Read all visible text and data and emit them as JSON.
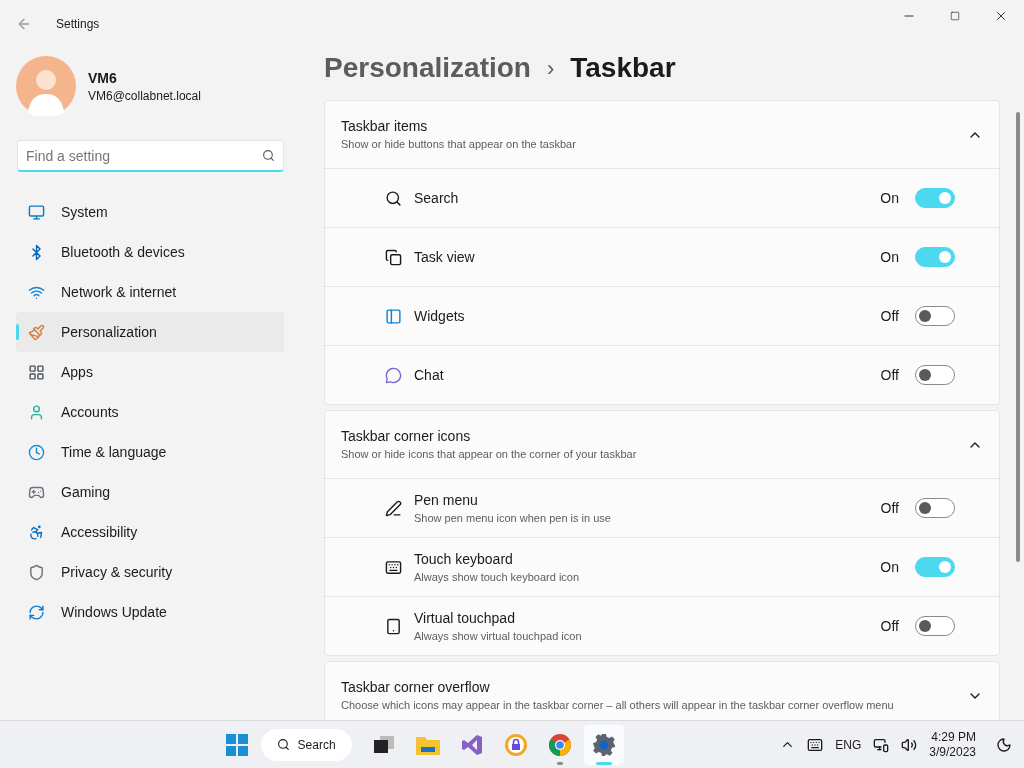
{
  "window": {
    "title": "Settings"
  },
  "profile": {
    "name": "VM6",
    "email": "VM6@collabnet.local"
  },
  "search": {
    "placeholder": "Find a setting"
  },
  "sidebar": {
    "items": [
      {
        "kind": "system",
        "label": "System",
        "selected": false
      },
      {
        "kind": "bluetooth",
        "label": "Bluetooth & devices",
        "selected": false
      },
      {
        "kind": "network",
        "label": "Network & internet",
        "selected": false
      },
      {
        "kind": "personalization",
        "label": "Personalization",
        "selected": true
      },
      {
        "kind": "apps",
        "label": "Apps",
        "selected": false
      },
      {
        "kind": "accounts",
        "label": "Accounts",
        "selected": false
      },
      {
        "kind": "time",
        "label": "Time & language",
        "selected": false
      },
      {
        "kind": "gaming",
        "label": "Gaming",
        "selected": false
      },
      {
        "kind": "accessibility",
        "label": "Accessibility",
        "selected": false
      },
      {
        "kind": "privacy",
        "label": "Privacy & security",
        "selected": false
      },
      {
        "kind": "update",
        "label": "Windows Update",
        "selected": false
      }
    ]
  },
  "breadcrumb": {
    "parent": "Personalization",
    "separator": "›",
    "current": "Taskbar"
  },
  "sections": [
    {
      "title": "Taskbar items",
      "subtitle": "Show or hide buttons that appear on the taskbar",
      "expanded": true,
      "items": [
        {
          "kind": "search",
          "label": "Search",
          "state": "On",
          "on": true
        },
        {
          "kind": "taskview",
          "label": "Task view",
          "state": "On",
          "on": true
        },
        {
          "kind": "widgets",
          "label": "Widgets",
          "state": "Off",
          "on": false
        },
        {
          "kind": "chat",
          "label": "Chat",
          "state": "Off",
          "on": false
        }
      ]
    },
    {
      "title": "Taskbar corner icons",
      "subtitle": "Show or hide icons that appear on the corner of your taskbar",
      "expanded": true,
      "items": [
        {
          "kind": "pen",
          "label": "Pen menu",
          "description": "Show pen menu icon when pen is in use",
          "state": "Off",
          "on": false
        },
        {
          "kind": "keyboard",
          "label": "Touch keyboard",
          "description": "Always show touch keyboard icon",
          "state": "On",
          "on": true
        },
        {
          "kind": "touchpad",
          "label": "Virtual touchpad",
          "description": "Always show virtual touchpad icon",
          "state": "Off",
          "on": false
        }
      ]
    },
    {
      "title": "Taskbar corner overflow",
      "subtitle": "Choose which icons may appear in the taskbar corner – all others will appear in the taskbar corner overflow menu",
      "expanded": false
    }
  ],
  "taskbar": {
    "search_label": "Search",
    "apps": [
      {
        "kind": "taskview",
        "running": false
      },
      {
        "kind": "explorer",
        "running": false
      },
      {
        "kind": "vs",
        "running": false
      },
      {
        "kind": "vpn",
        "running": false
      },
      {
        "kind": "chrome",
        "running": true
      },
      {
        "kind": "settings",
        "running": true
      }
    ],
    "language": "ENG",
    "time": "4:29 PM",
    "date": "3/9/2023"
  }
}
